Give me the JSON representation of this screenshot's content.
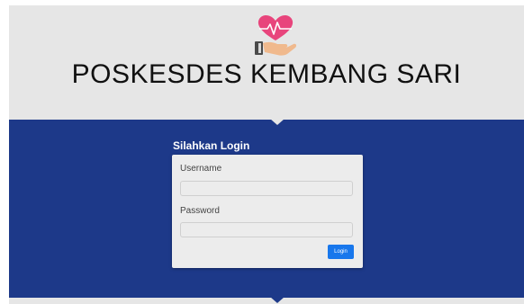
{
  "header": {
    "logo_icon": "heart-in-hand-icon",
    "title": "POSKESDES KEMBANG SARI"
  },
  "login": {
    "heading": "Silahkan Login",
    "username_label": "Username",
    "username_value": "",
    "password_label": "Password",
    "password_value": "",
    "submit_label": "Login"
  },
  "colors": {
    "header_bg": "#e6e6e6",
    "band_bg": "#1d3989",
    "panel_bg": "#ececec",
    "button_bg": "#1877ec",
    "logo_heart": "#e8457c"
  }
}
